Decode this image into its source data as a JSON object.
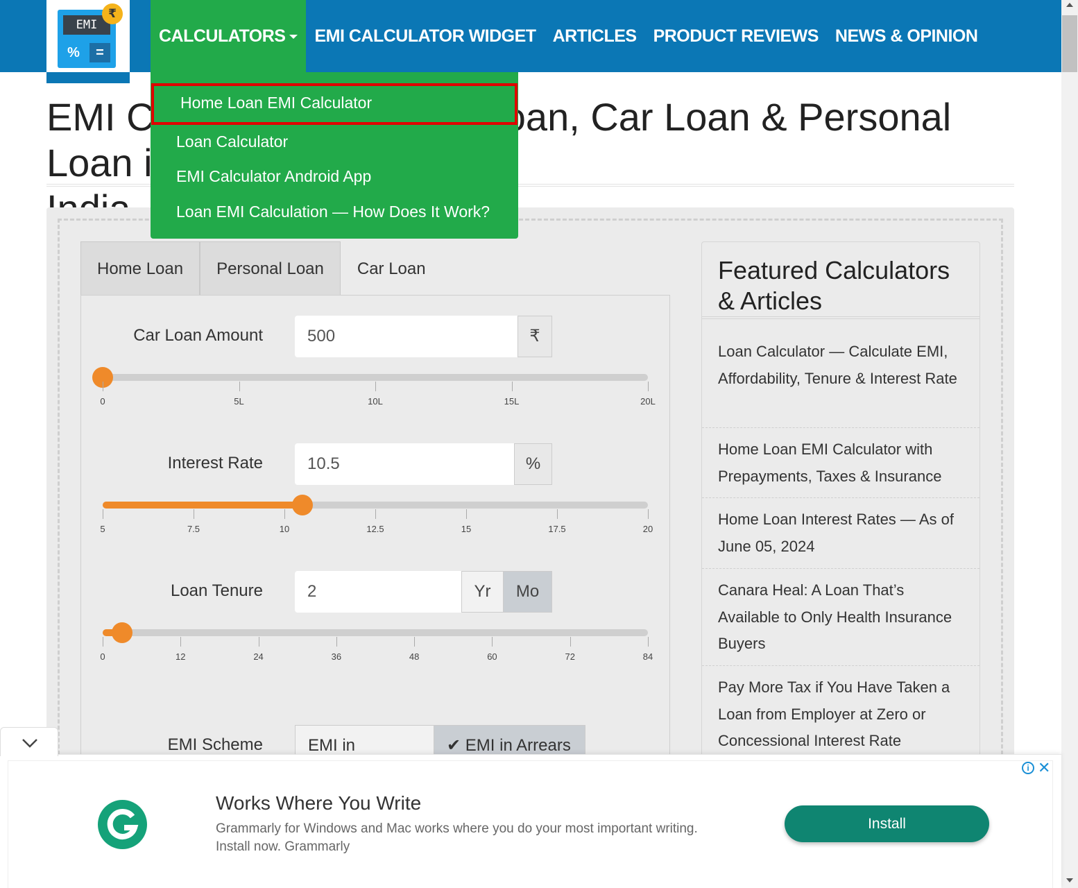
{
  "logo": {
    "screen_text": "EMI",
    "pct": "%",
    "eq": "=",
    "rupee": "₹"
  },
  "nav": {
    "items": [
      {
        "label": "CALCULATORS"
      },
      {
        "label": "EMI CALCULATOR WIDGET"
      },
      {
        "label": "ARTICLES"
      },
      {
        "label": "PRODUCT REVIEWS"
      },
      {
        "label": "NEWS & OPINION"
      }
    ]
  },
  "dropdown": {
    "items": [
      {
        "label": "Home Loan EMI Calculator"
      },
      {
        "label": "Loan Calculator"
      },
      {
        "label": "EMI Calculator Android App"
      },
      {
        "label": "Loan EMI Calculation — How Does It Work?"
      }
    ]
  },
  "page": {
    "title_line1": "EMI Calculator for Home Loan, Car Loan & Personal Loan in",
    "title_line2": "India"
  },
  "calculator": {
    "tabs": [
      {
        "label": "Home Loan"
      },
      {
        "label": "Personal Loan"
      },
      {
        "label": "Car Loan"
      }
    ],
    "amount": {
      "label": "Car Loan Amount",
      "value": "500",
      "unit": "₹",
      "slider_fraction": 0.0,
      "ticks": [
        "0",
        "5L",
        "10L",
        "15L",
        "20L"
      ]
    },
    "rate": {
      "label": "Interest Rate",
      "value": "10.5",
      "unit": "%",
      "slider_fraction": 0.367,
      "ticks": [
        "5",
        "7.5",
        "10",
        "12.5",
        "15",
        "17.5",
        "20"
      ]
    },
    "tenure": {
      "label": "Loan Tenure",
      "value": "2",
      "unit_year": "Yr",
      "unit_month": "Mo",
      "slider_fraction": 0.036,
      "ticks": [
        "0",
        "12",
        "24",
        "36",
        "48",
        "60",
        "72",
        "84"
      ]
    },
    "scheme": {
      "label": "EMI Scheme",
      "option_advance": "EMI in Advance",
      "option_arrears": "EMI in Arrears",
      "checkmark": "✔"
    }
  },
  "sidebar": {
    "title": "Featured Calculators & Articles",
    "links": [
      {
        "label": "Loan Calculator — Calculate EMI, Affordability, Tenure & Interest Rate"
      },
      {
        "label": "Home Loan EMI Calculator with Prepayments, Taxes & Insurance"
      },
      {
        "label": "Home Loan Interest Rates — As of June 05, 2024"
      },
      {
        "label": "Canara Heal: A Loan That’s Available to Only Health Insurance Buyers"
      },
      {
        "label": "Pay More Tax if You Have Taken a Loan from Employer at Zero or Concessional Interest Rate"
      }
    ]
  },
  "ad": {
    "title": "Works Where You Write",
    "text": "Grammarly for Windows and Mac works where you do your most important writing. Install now. Grammarly",
    "button": "Install",
    "info": "i",
    "close": "✕",
    "logo_letter": "G"
  },
  "colors": {
    "header_blue": "#0b77b5",
    "menu_green": "#22aa4a",
    "slider_orange": "#ef8a2a",
    "ad_button": "#0f8571"
  }
}
